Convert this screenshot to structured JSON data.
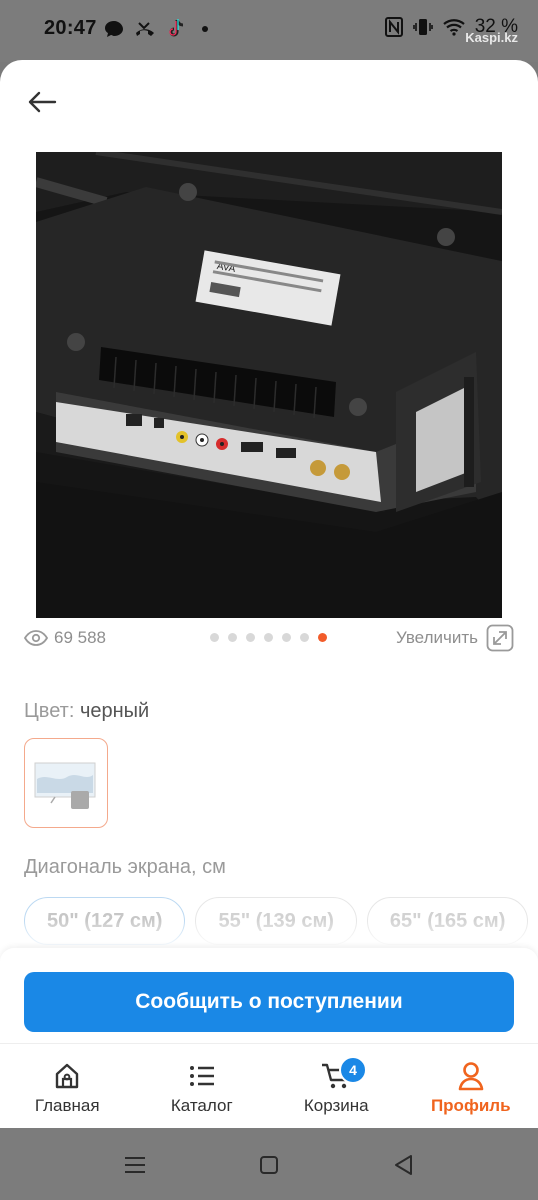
{
  "status_bar": {
    "time": "20:47",
    "battery": "32 %",
    "watermark": "Kaspi.kz"
  },
  "product": {
    "views": "69 588",
    "gallery_total": 7,
    "gallery_active": 7,
    "zoom_label": "Увеличить"
  },
  "color": {
    "label": "Цвет:",
    "value": "черный"
  },
  "diagonal": {
    "label": "Диагональ экрана, см",
    "options": [
      "50\" (127 см)",
      "55\" (139 см)",
      "65\" (165 см)"
    ]
  },
  "notify_button": "Сообщить о поступлении",
  "tabbar": {
    "items": [
      {
        "label": "Главная",
        "icon": "home-icon"
      },
      {
        "label": "Каталог",
        "icon": "list-icon"
      },
      {
        "label": "Корзина",
        "icon": "cart-icon",
        "badge": "4"
      },
      {
        "label": "Профиль",
        "icon": "profile-icon"
      }
    ]
  },
  "colors": {
    "primary": "#1a88e6",
    "accent": "#f0641e"
  }
}
